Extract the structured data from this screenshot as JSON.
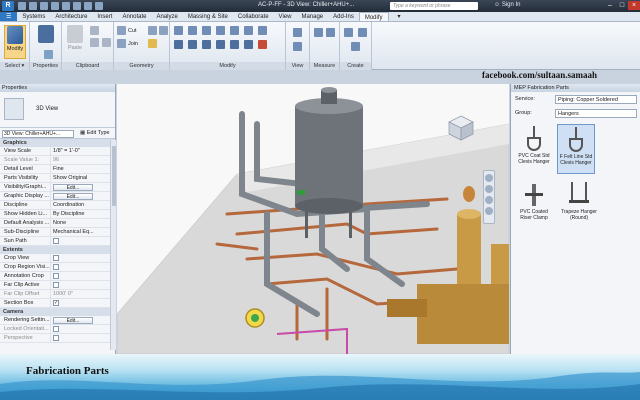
{
  "window": {
    "title": "AC-P-FF - 3D View: Chiller+AHU+...",
    "search_placeholder": "Type a keyword or phrase",
    "sign_in": "Sign In"
  },
  "ribbon": {
    "tabs": [
      "Systems",
      "Architecture",
      "Insert",
      "Annotate",
      "Analyze",
      "Massing & Site",
      "Collaborate",
      "View",
      "Manage",
      "Add-Ins",
      "Modify"
    ],
    "active_tab": "Modify",
    "modify_label": "Modify",
    "select_label": "Select ▾",
    "properties_label": "Properties",
    "paste_label": "Paste",
    "cut_label": "Cut",
    "join_label": "Join",
    "group_labels": {
      "clipboard": "Clipboard",
      "geometry": "Geometry",
      "modify": "Modify",
      "view": "View",
      "measure": "Measure",
      "create": "Create"
    }
  },
  "overlay": {
    "facebook": "facebook.com/sultaan.samaah",
    "banner_title": "Fabrication Parts"
  },
  "properties": {
    "header": "Properties",
    "type_name": "3D View",
    "view_selector": "3D View: Chiller+AHU+...",
    "edit_type": "Edit Type",
    "categories": {
      "graphics": "Graphics",
      "extents": "Extents",
      "camera": "Camera"
    },
    "rows": {
      "view_scale": {
        "k": "View Scale",
        "v": "1/8\" = 1'-0\""
      },
      "scale_value": {
        "k": "Scale Value 1:",
        "v": "96"
      },
      "detail_level": {
        "k": "Detail Level",
        "v": "Fine"
      },
      "parts_visibility": {
        "k": "Parts Visibility",
        "v": "Show Original"
      },
      "visibility_graphics": {
        "k": "Visibility/Graphi...",
        "v": "Edit..."
      },
      "graphic_display": {
        "k": "Graphic Display ...",
        "v": "Edit..."
      },
      "discipline": {
        "k": "Discipline",
        "v": "Coordination"
      },
      "show_hidden": {
        "k": "Show Hidden Li...",
        "v": "By Discipline"
      },
      "default_analysis": {
        "k": "Default Analysis ...",
        "v": "None"
      },
      "sub_discipline": {
        "k": "Sub-Discipline",
        "v": "Mechanical Eq..."
      },
      "sun_path": {
        "k": "Sun Path",
        "v": ""
      },
      "crop_view": {
        "k": "Crop View",
        "v": ""
      },
      "crop_region": {
        "k": "Crop Region Visi...",
        "v": ""
      },
      "annotation_crop": {
        "k": "Annotation Crop",
        "v": ""
      },
      "far_clip_active": {
        "k": "Far Clip Active",
        "v": ""
      },
      "far_clip_offset": {
        "k": "Far Clip Offset",
        "v": "1000'  0\""
      },
      "section_box": {
        "k": "Section Box",
        "v": "✓"
      },
      "rendering_settings": {
        "k": "Rendering Settin...",
        "v": "Edit..."
      },
      "locked_orientation": {
        "k": "Locked Orientati...",
        "v": ""
      },
      "perspective": {
        "k": "Perspective",
        "v": ""
      }
    }
  },
  "mep_panel": {
    "header": "MEP Fabrication Parts",
    "service_label": "Service:",
    "service_value": "Piping: Copper Soldered",
    "group_label": "Group:",
    "group_value": "Hangers",
    "parts": [
      {
        "label": "PVC Coat Std Clevis Hanger",
        "selected": false
      },
      {
        "label": "F Felt Line Std Clevis Hanger",
        "selected": true
      },
      {
        "label": "PVC Coated Riser Clamp",
        "selected": false
      },
      {
        "label": "Trapeze Hanger (Round)",
        "selected": false
      }
    ]
  },
  "colors": {
    "pipe_grey": "#7f858c",
    "pipe_copper": "#b5683c",
    "equipment_gold": "#c89a45",
    "accent_blue": "#2f78c4"
  }
}
